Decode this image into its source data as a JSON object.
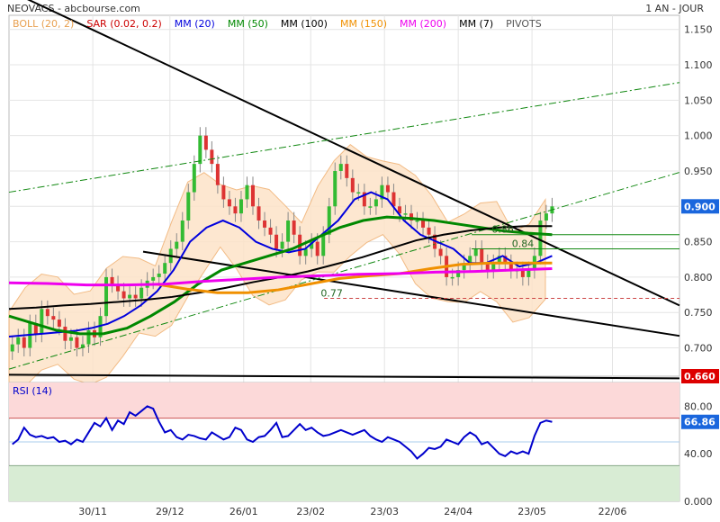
{
  "header": {
    "title": "NEOVACS - abcbourse.com",
    "period": "1 AN - JOUR",
    "legend": [
      {
        "label": "BOLL (20, 2)",
        "color": "#e8a050"
      },
      {
        "label": "SAR (0.02, 0.2)",
        "color": "#cc0000"
      },
      {
        "label": "MM (20)",
        "color": "#0000dd"
      },
      {
        "label": "MM (50)",
        "color": "#008800"
      },
      {
        "label": "MM (100)",
        "color": "#000000"
      },
      {
        "label": "MM (150)",
        "color": "#f09000"
      },
      {
        "label": "MM (200)",
        "color": "#ee00ee"
      },
      {
        "label": "MM (7)",
        "color": "#000000"
      },
      {
        "label": "PIVOTS",
        "color": "#555555"
      }
    ]
  },
  "chart_data": [
    {
      "type": "candlestick",
      "x_ticks": [
        "30/11",
        "29/12",
        "26/01",
        "23/02",
        "23/03",
        "24/04",
        "23/05",
        "22/06"
      ],
      "ylim": [
        0.66,
        1.17
      ],
      "y_ticks": [
        "1.150",
        "1.100",
        "1.050",
        "1.000",
        "0.950",
        "0.900",
        "0.850",
        "0.800",
        "0.750",
        "0.700"
      ],
      "last_price": "0.900",
      "support_label": "0.660",
      "pivot_labels": [
        {
          "text": "0.86",
          "value": 0.86
        },
        {
          "text": "0.84",
          "value": 0.84
        },
        {
          "text": "0.77",
          "value": 0.77
        }
      ],
      "close": [
        0.705,
        0.715,
        0.7,
        0.735,
        0.72,
        0.755,
        0.745,
        0.74,
        0.73,
        0.71,
        0.715,
        0.7,
        0.705,
        0.725,
        0.715,
        0.745,
        0.8,
        0.79,
        0.78,
        0.77,
        0.775,
        0.77,
        0.785,
        0.795,
        0.8,
        0.805,
        0.82,
        0.84,
        0.85,
        0.88,
        0.92,
        0.96,
        1.0,
        0.98,
        0.96,
        0.93,
        0.91,
        0.9,
        0.89,
        0.91,
        0.93,
        0.9,
        0.88,
        0.87,
        0.86,
        0.84,
        0.85,
        0.88,
        0.86,
        0.83,
        0.84,
        0.85,
        0.83,
        0.86,
        0.9,
        0.95,
        0.96,
        0.94,
        0.92,
        0.92,
        0.9,
        0.9,
        0.91,
        0.93,
        0.92,
        0.9,
        0.89,
        0.89,
        0.88,
        0.88,
        0.87,
        0.86,
        0.84,
        0.83,
        0.8,
        0.8,
        0.81,
        0.82,
        0.83,
        0.84,
        0.82,
        0.81,
        0.82,
        0.83,
        0.82,
        0.81,
        0.81,
        0.8,
        0.81,
        0.83,
        0.88,
        0.89,
        0.9
      ],
      "series": [
        {
          "name": "MM (20)",
          "color": "#0000dd",
          "values": [
            0.716,
            0.718,
            0.72,
            0.722,
            0.724,
            0.728,
            0.734,
            0.745,
            0.76,
            0.78,
            0.81,
            0.85,
            0.87,
            0.88,
            0.87,
            0.85,
            0.84,
            0.835,
            0.84,
            0.86,
            0.88,
            0.91,
            0.92,
            0.91,
            0.88,
            0.86,
            0.85,
            0.84,
            0.82,
            0.82,
            0.83,
            0.815,
            0.82,
            0.83
          ]
        },
        {
          "name": "MM (50)",
          "color": "#008800",
          "values": [
            0.745,
            0.735,
            0.725,
            0.72,
            0.72,
            0.728,
            0.745,
            0.765,
            0.79,
            0.81,
            0.82,
            0.83,
            0.84,
            0.855,
            0.87,
            0.88,
            0.885,
            0.883,
            0.88,
            0.875,
            0.87,
            0.865,
            0.862,
            0.86
          ]
        },
        {
          "name": "MM (100)",
          "color": "#000000",
          "values": [
            0.755,
            0.757,
            0.76,
            0.762,
            0.765,
            0.768,
            0.772,
            0.778,
            0.785,
            0.793,
            0.8,
            0.808,
            0.818,
            0.828,
            0.84,
            0.852,
            0.86,
            0.866,
            0.87,
            0.872,
            0.872
          ]
        },
        {
          "name": "MM (150)",
          "color": "#f09000",
          "values": [
            0.79,
            0.783,
            0.778,
            0.778,
            0.782,
            0.79,
            0.798,
            0.802,
            0.805,
            0.812,
            0.818,
            0.82,
            0.82,
            0.82
          ]
        },
        {
          "name": "MM (200)",
          "color": "#ee00ee",
          "values": [
            0.792,
            0.791,
            0.789,
            0.789,
            0.79,
            0.794,
            0.797,
            0.8,
            0.802,
            0.804,
            0.805,
            0.807,
            0.808,
            0.81,
            0.812
          ]
        }
      ],
      "trendlines": [
        {
          "from": [
            0.0,
            1.205
          ],
          "to": [
            1.0,
            0.76
          ],
          "color": "#000000"
        },
        {
          "from": [
            0.2,
            0.836
          ],
          "to": [
            1.0,
            0.717
          ],
          "color": "#000000"
        },
        {
          "from": [
            0.0,
            0.662
          ],
          "to": [
            1.0,
            0.657
          ],
          "color": "#000000"
        },
        {
          "from": [
            0.0,
            0.92
          ],
          "to": [
            1.0,
            1.075
          ],
          "color": "#118811"
        },
        {
          "from": [
            0.0,
            0.67
          ],
          "to": [
            1.0,
            0.948
          ],
          "color": "#118811"
        }
      ]
    },
    {
      "type": "line",
      "title": "RSI (14)",
      "ylim": [
        0,
        100
      ],
      "y_ticks": [
        "80.00",
        "40.00",
        "0.000"
      ],
      "overbought": 70,
      "oversold": 30,
      "last_value": "66.86",
      "series": [
        {
          "name": "RSI (14)",
          "color": "#0000cc",
          "values": [
            48,
            52,
            62,
            56,
            54,
            55,
            53,
            54,
            50,
            51,
            48,
            52,
            50,
            58,
            66,
            63,
            70,
            60,
            68,
            65,
            75,
            72,
            76,
            80,
            78,
            67,
            58,
            60,
            54,
            52,
            56,
            55,
            53,
            52,
            58,
            55,
            52,
            54,
            62,
            60,
            52,
            50,
            54,
            55,
            60,
            66,
            54,
            55,
            60,
            65,
            60,
            62,
            58,
            55,
            56,
            58,
            60,
            58,
            56,
            58,
            60,
            55,
            52,
            50,
            54,
            52,
            50,
            46,
            42,
            36,
            40,
            45,
            44,
            46,
            52,
            50,
            48,
            54,
            58,
            55,
            48,
            50,
            45,
            40,
            38,
            42,
            40,
            42,
            40,
            55,
            66,
            68,
            66.86
          ]
        }
      ]
    }
  ]
}
